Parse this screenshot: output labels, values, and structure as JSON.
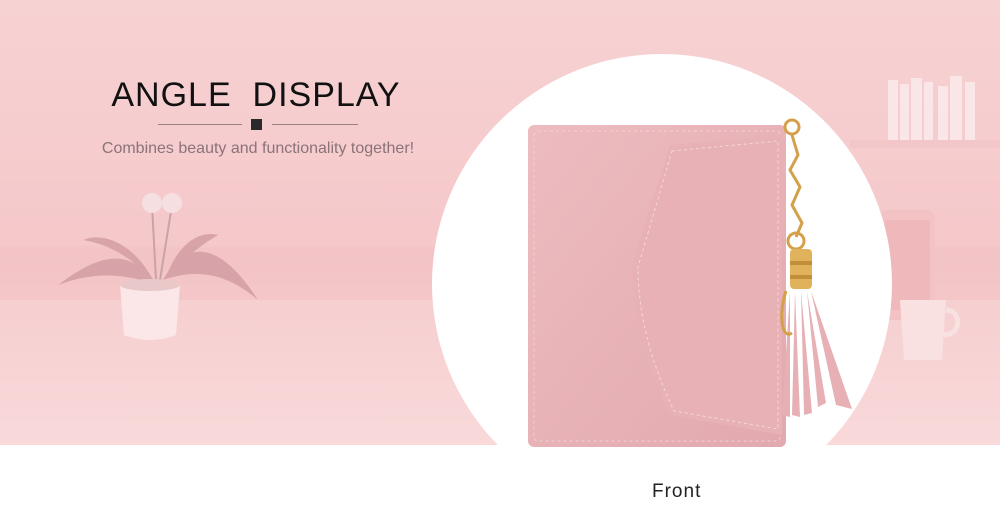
{
  "heading": {
    "title": "ANGLE  DISPLAY",
    "subtitle": "Combines beauty and functionality together!"
  },
  "caption": "Front",
  "colors": {
    "background_pink": "#f5c8ca",
    "wallet_pink": "#e8b4b8",
    "accent_gold": "#d4a04a"
  }
}
